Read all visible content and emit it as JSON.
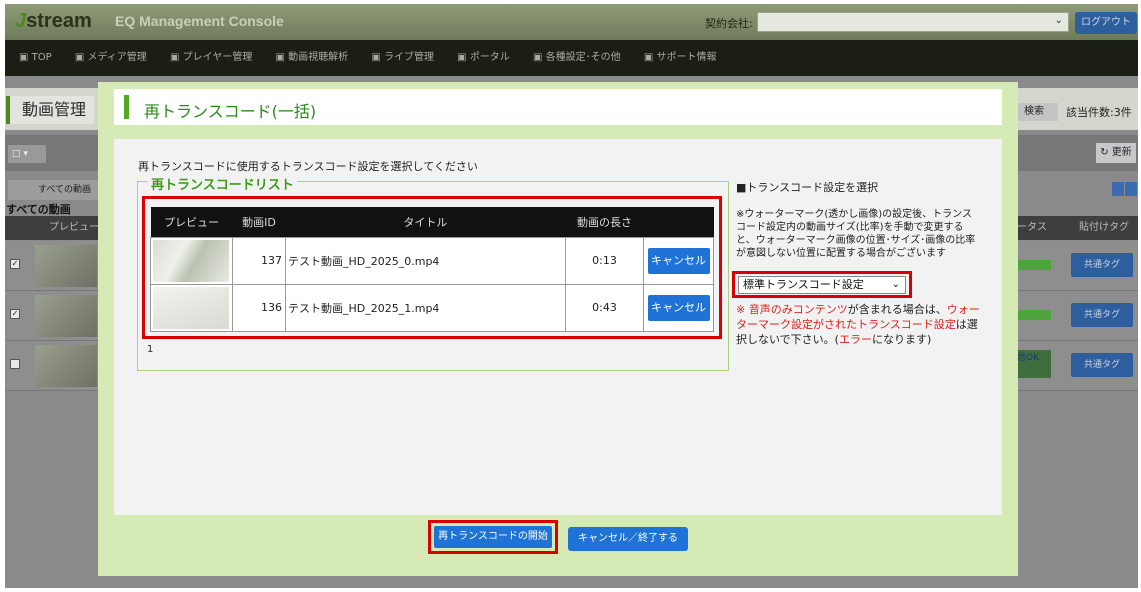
{
  "app": {
    "logo_text": "stream",
    "logo_mark": "J",
    "console_title": "EQ Management Console",
    "company_label": "契約会社:",
    "company_value": "",
    "logout_label": "ログアウト"
  },
  "nav": {
    "items": [
      {
        "label": "TOP"
      },
      {
        "label": "メディア管理"
      },
      {
        "label": "プレイヤー管理"
      },
      {
        "label": "動画視聴解析"
      },
      {
        "label": "ライブ管理"
      },
      {
        "label": "ポータル"
      },
      {
        "label": "各種設定･その他"
      },
      {
        "label": "サポート情報"
      }
    ]
  },
  "background": {
    "page_title": "動画管理",
    "search_label": "検索",
    "count_label": "該当件数:3件",
    "refresh_label": "更新",
    "tab_label": "すべての動画",
    "all_videos_label": "すべての動画",
    "col_preview": "プレビュー",
    "col_status": "ータス",
    "col_tag": "貼付けタグ",
    "tag_button": "共通タグ",
    "status_ok": "信OK"
  },
  "modal": {
    "title": "再トランスコード(一括)",
    "instruction": "再トランスコードに使用するトランスコード設定を選択してください",
    "list_legend": "再トランスコードリスト",
    "columns": {
      "preview": "プレビュー",
      "id": "動画ID",
      "title": "タイトル",
      "length": "動画の長さ"
    },
    "rows": [
      {
        "id": "137",
        "title": "テスト動画_HD_2025_0.mp4",
        "length": "0:13",
        "action": "キャンセル"
      },
      {
        "id": "136",
        "title": "テスト動画_HD_2025_1.mp4",
        "length": "0:43",
        "action": "キャンセル"
      }
    ],
    "page_number": "1",
    "side_title": "■トランスコード設定を選択",
    "side_note": "※ウォーターマーク(透かし画像)の設定後、トランスコード設定内の動画サイズ(比率)を手動で変更すると、ウォーターマーク画像の位置･サイズ･画像の比率が意図しない位置に配置する場合がございます",
    "select_value": "標準トランスコード設定",
    "warning": {
      "p1": "※ 音声のみコンテンツ",
      "p2": "が含まれる場合は、",
      "p3": "ウォーターマーク設定がされたトランスコード設定",
      "p4": "は選択しないで下さい。(",
      "p5": "エラー",
      "p6": "になります)"
    },
    "start_button": "再トランスコードの開始",
    "end_button": "キャンセル／終了する"
  }
}
